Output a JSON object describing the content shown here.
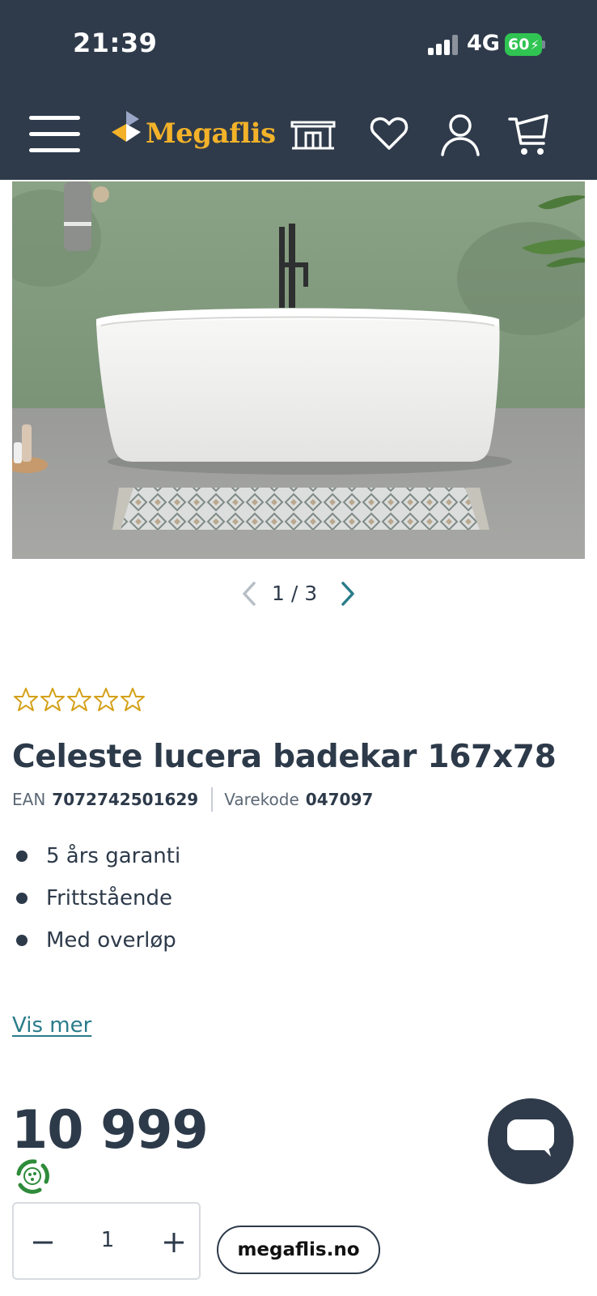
{
  "status_bar": {
    "time": "21:39",
    "network": "4G",
    "battery": "60",
    "battery_charging": true
  },
  "header": {
    "logo_text": "Megaflis",
    "logo_color": "#f3b229",
    "background": "#2f3b4b",
    "icons": [
      "menu-icon",
      "store-icon",
      "heart-icon",
      "user-icon",
      "cart-icon"
    ]
  },
  "gallery": {
    "current": 1,
    "total": 3,
    "pager_text": "1 / 3"
  },
  "product": {
    "rating_stars": 5,
    "rating_value": 0,
    "title": "Celeste lucera badekar 167x78",
    "ean_label": "EAN",
    "ean": "7072742501629",
    "sku_label": "Varekode",
    "sku": "047097",
    "usps": [
      "5 års garanti",
      "Frittstående",
      "Med overløp"
    ],
    "show_more": "Vis mer",
    "price": "10 999"
  },
  "cart": {
    "quantity": "1"
  },
  "site_pill": "megaflis.no",
  "colors": {
    "accent": "#2a7c8a",
    "text": "#2d3a4a",
    "star": "#d4a017"
  }
}
